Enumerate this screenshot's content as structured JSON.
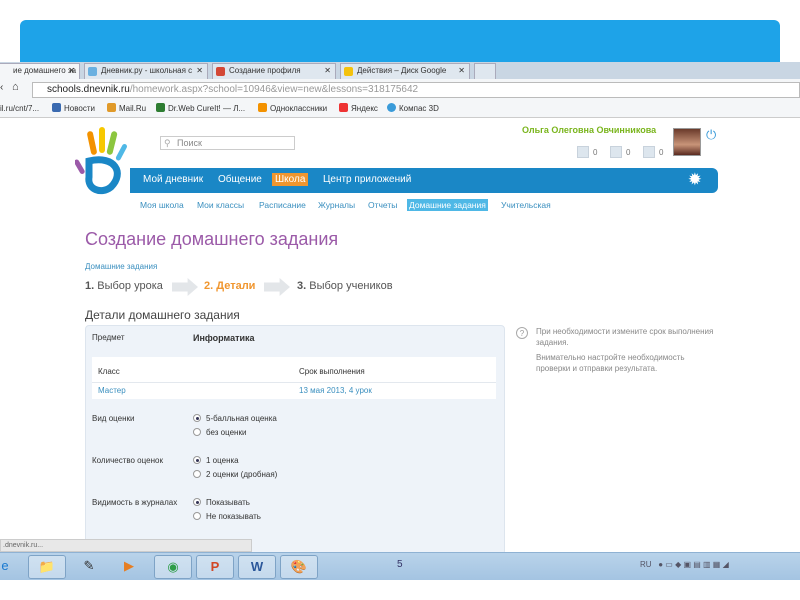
{
  "browser": {
    "tabs": [
      {
        "label": "ие домашнего за",
        "active": true
      },
      {
        "label": "Дневник.ру - школьная с",
        "active": false
      },
      {
        "label": "Создание профиля",
        "active": false
      },
      {
        "label": "Действия – Диск Google",
        "active": false
      }
    ],
    "url_domain": "schools.dnevnik.ru",
    "url_path": "/homework.aspx?school=10946&view=new&lessons=318175642",
    "bookmarks": [
      "il.ru/cnt/7...",
      "Новости",
      "Mail.Ru",
      "Dr.Web CureIt! — Л...",
      "Одноклассники",
      "Яндекс",
      "Компас 3D"
    ],
    "status_text": ".dnevnik.ru..."
  },
  "header": {
    "search_placeholder": "Поиск",
    "user_name": "Ольга Олеговна Овчинникова",
    "counters": [
      "0",
      "0",
      "0"
    ],
    "nav": [
      "Мой дневник",
      "Общение",
      "Школа",
      "Центр приложений"
    ],
    "subnav": [
      "Моя школа",
      "Мои классы",
      "Расписание",
      "Журналы",
      "Отчеты",
      "Домашние задания",
      "Учительская"
    ]
  },
  "page": {
    "title": "Создание домашнего задания",
    "breadcrumb": "Домашние задания",
    "steps": [
      {
        "num": "1.",
        "label": "Выбор урока"
      },
      {
        "num": "2.",
        "label": "Детали"
      },
      {
        "num": "3.",
        "label": "Выбор учеников"
      }
    ],
    "section_title": "Детали домашнего задания",
    "subject_label": "Предмет",
    "subject_value": "Информатика",
    "class_header": "Класс",
    "deadline_header": "Срок выполнения",
    "class_value": "Мастер",
    "deadline_value": "13 мая 2013, 4 урок",
    "grade_type_label": "Вид оценки",
    "grade_type_options": [
      "5-балльная оценка",
      "без оценки"
    ],
    "grade_count_label": "Количество оценок",
    "grade_count_options": [
      "1 оценка",
      "2 оценки (дробная)"
    ],
    "visibility_label": "Видимость в журналах",
    "visibility_options": [
      "Показывать",
      "Не показывать"
    ],
    "hints": [
      "При необходимости измените срок выполнения задания.",
      "Внимательно настройте необходимость проверки и отправки результата."
    ]
  },
  "taskbar": {
    "page_number": "5",
    "lang": "RU"
  }
}
